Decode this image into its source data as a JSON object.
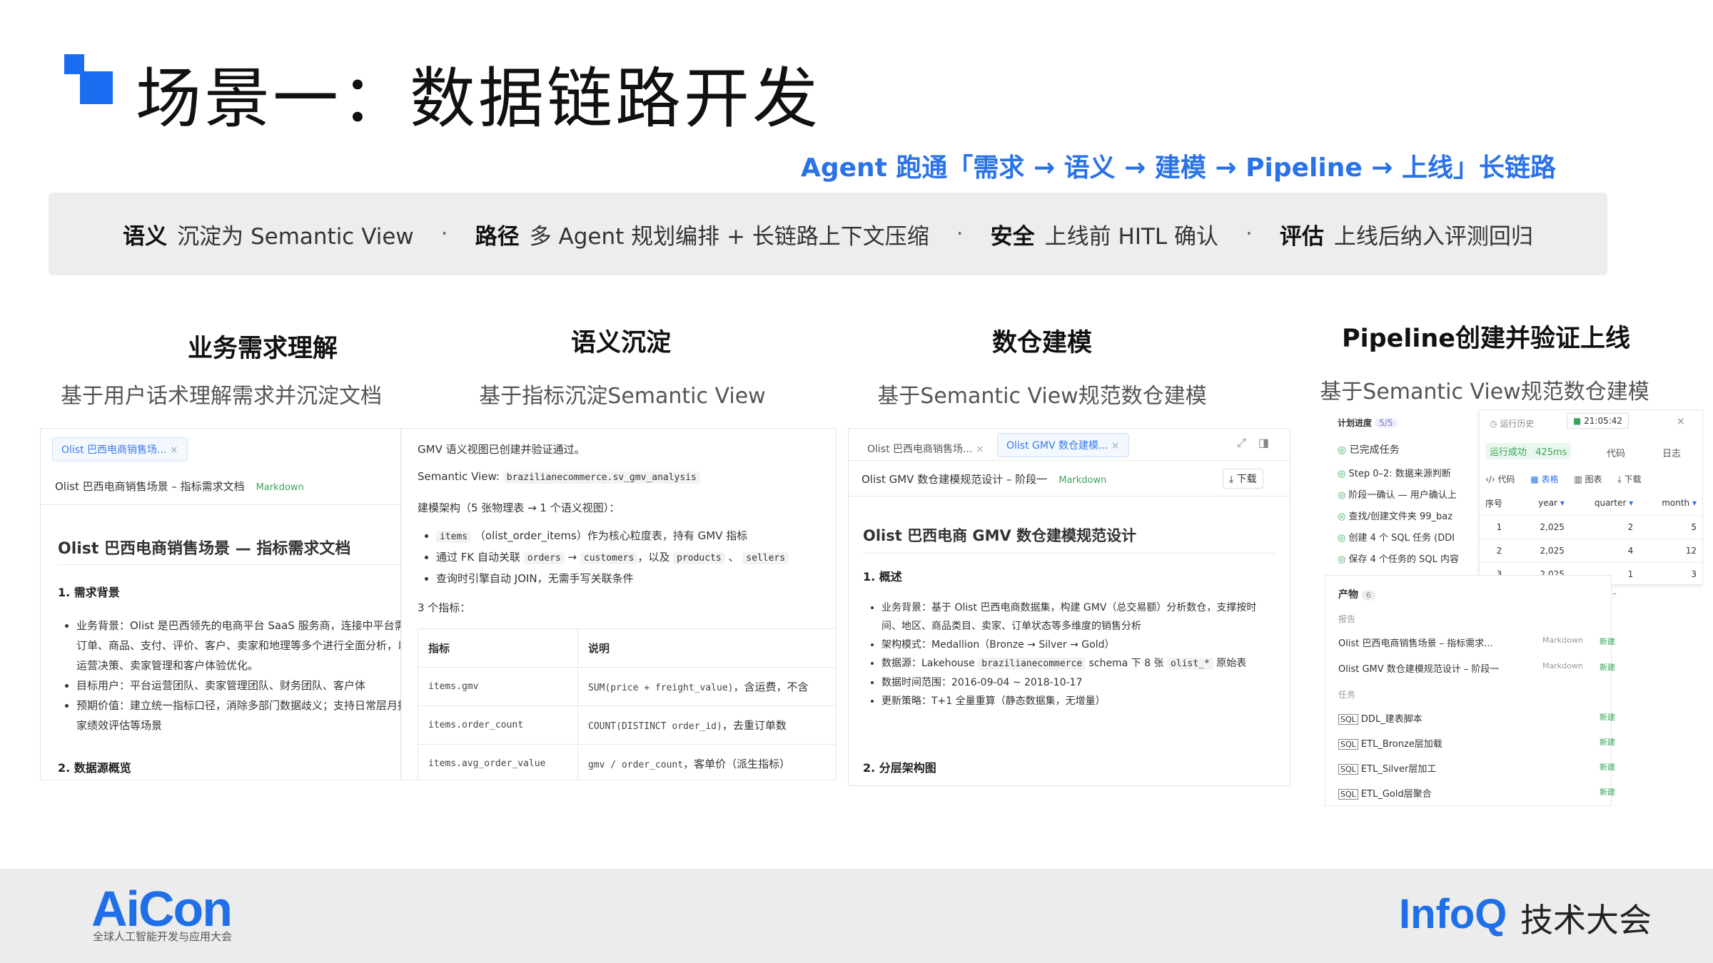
{
  "header": {
    "title": "场景一：数据链路开发",
    "subtitle": "Agent 跑通「需求 → 语义 → 建模 → Pipeline → 上线」长链路"
  },
  "banner": {
    "items": [
      {
        "key": "语义",
        "text": "沉淀为 Semantic View"
      },
      {
        "key": "路径",
        "text": "多 Agent 规划编排 + 长链路上下文压缩"
      },
      {
        "key": "安全",
        "text": "上线前 HITL 确认"
      },
      {
        "key": "评估",
        "text": "上线后纳入评测回归"
      }
    ],
    "separator": "·"
  },
  "columns": [
    {
      "heading": "业务需求理解",
      "sub": "基于用户话术理解需求并沉淀文档"
    },
    {
      "heading": "语义沉淀",
      "sub": "基于指标沉淀Semantic View"
    },
    {
      "heading": "数仓建模",
      "sub": "基于Semantic View规范数仓建模"
    },
    {
      "heading": "Pipeline创建并验证上线",
      "sub": "基于Semantic View规范数仓建模"
    }
  ],
  "panel1": {
    "tab": "Olist 巴西电商销售场...",
    "doc_title": "Olist 巴西电商销售场景 – 指标需求文档",
    "badge": "Markdown",
    "h1": "Olist 巴西电商销售场景 — 指标需求文档",
    "sec1": "1. 需求背景",
    "bullets": [
      "业务背景：Olist 是巴西领先的电商平台 SaaS 服务商，连接中平台需要从订单、商品、支付、评价、客户、卖家和地理等多个进行全面分析，以支撑运营决策、卖家管理和客户体验优化。",
      "目标用户：平台运营团队、卖家管理团队、财务团队、客户体",
      "预期价值：建立统一指标口径，消除多部门数据歧义；支持日常层月报、卖家绩效评估等场景"
    ],
    "sec2": "2. 数据源概览"
  },
  "panel2": {
    "line1": "GMV 语义视图已创建并验证通过。",
    "sv_label": "Semantic View:",
    "sv_name": "brazilianecommerce.sv_gmv_analysis",
    "arch": "建模架构（5 张物理表 → 1 个语义视图）：",
    "b1_code": "items",
    "b1_text": "（olist_order_items）作为核心粒度表，持有 GMV 指标",
    "b2_pre": "通过 FK 自动关联",
    "b2_c1": "orders",
    "b2_c2": "customers",
    "b2_mid": "，以及",
    "b2_c3": "products",
    "b2_c4": "sellers",
    "b3": "查询时引擎自动 JOIN，无需手写关联条件",
    "metrics_count": "3 个指标：",
    "th1": "指标",
    "th2": "说明",
    "rows": [
      {
        "m": "items.gmv",
        "d": "SUM(price + freight_value)",
        "d2": "，含运费，不含"
      },
      {
        "m": "items.order_count",
        "d": "COUNT(DISTINCT order_id)",
        "d2": "，去重订单数"
      },
      {
        "m": "items.avg_order_value",
        "d": "gmv / order_count",
        "d2": "，客单价（派生指标）"
      }
    ]
  },
  "panel3": {
    "tab1": "Olist 巴西电商销售场...",
    "tab2": "Olist GMV 数仓建模...",
    "doc_title": "Olist GMV 数仓建模规范设计 – 阶段一",
    "badge": "Markdown",
    "download": "下载",
    "h1": "Olist 巴西电商 GMV 数仓建模规范设计",
    "sec1": "1. 概述",
    "b1": "业务背景：基于 Olist 巴西电商数据集，构建 GMV（总交易额）分析数仓，支撑按时间、地区、商品类目、卖家、订单状态等多维度的销售分析",
    "b2": "架构模式：Medallion（Bronze → Silver → Gold）",
    "b3_pre": "数据源：Lakehouse",
    "b3_c1": "brazilianecommerce",
    "b3_mid": "schema 下 8 张",
    "b3_c2": "olist_*",
    "b3_post": "原始表",
    "b4": "数据时间范围：2016-09-04 ~ 2018-10-17",
    "b5": "更新策略：T+1 全量重算（静态数据集，无增量）",
    "sec2": "2. 分层架构图"
  },
  "panel4": {
    "progress_label": "计划进度",
    "progress_count": "5/5",
    "history": "运行历史",
    "time": "21:05:42",
    "close": "×",
    "done": "已完成任务",
    "steps": [
      "Step 0–2: 数据来源判断",
      "阶段一确认 — 用户确认上",
      "查找/创建文件夹 99_baz",
      "创建 4 个 SQL 任务 (DDI",
      "保存 4 个任务的 SQL 内容"
    ],
    "run_ok": "运行成功",
    "run_ms": "425ms",
    "tab_code": "代码",
    "tab_log": "日志",
    "view_code": "代码",
    "view_table": "表格",
    "view_chart": "图表",
    "view_download": "下载",
    "cols": [
      "序号",
      "year",
      "quarter",
      "month"
    ],
    "rows": [
      [
        "1",
        "2,025",
        "2",
        "5"
      ],
      [
        "2",
        "2,025",
        "4",
        "12"
      ],
      [
        "3",
        "2,025",
        "1",
        "3"
      ]
    ],
    "products_label": "产物",
    "products_count": "6",
    "report_label": "报告",
    "reports": [
      {
        "name": "Olist 巴西电商销售场景 – 指标需求...",
        "fmt": "Markdown",
        "tag": "新建"
      },
      {
        "name": "Olist GMV 数仓建模规范设计 – 阶段一",
        "fmt": "Markdown",
        "tag": "新建"
      }
    ],
    "task_label": "任务",
    "tasks": [
      {
        "name": "DDL_建表脚本",
        "tag": "新建"
      },
      {
        "name": "ETL_Bronze层加载",
        "tag": "新建"
      },
      {
        "name": "ETL_Silver层加工",
        "tag": "新建"
      },
      {
        "name": "ETL_Gold层聚合",
        "tag": "新建"
      }
    ]
  },
  "footer": {
    "aicon": "AiCon",
    "aicon_sub": "全球人工智能开发与应用大会",
    "infoq": "InfoQ",
    "infoq_cn": "技术大会"
  },
  "colors": {
    "accent": "#1a6cf0",
    "green": "#37a65a"
  }
}
